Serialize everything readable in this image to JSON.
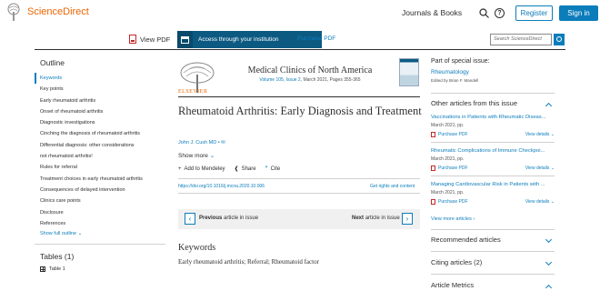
{
  "header": {
    "brand": "ScienceDirect",
    "journals_link": "Journals & Books",
    "help_glyph": "?",
    "register": "Register",
    "signin": "Sign in"
  },
  "toolbar": {
    "view_pdf": "View PDF",
    "access": "Access through your institution",
    "purchase_pdf": "Purchase PDF",
    "search_placeholder": "Search ScienceDirect"
  },
  "outline": {
    "title": "Outline",
    "items": [
      "Keywords",
      "Key points",
      "Early rheumatoid arthritis",
      "Onset of rheumatoid arthritis",
      "Diagnostic investigations",
      "Cinching the diagnosis of rheumatoid arthritis",
      "Differential diagnosis: other considerations",
      "not rheumatoid arthritis!",
      "Rules for referral",
      "Treatment choices in early rheumatoid arthritis",
      "Consequences of delayed intervention",
      "Clinics care points",
      "Disclosure",
      "References"
    ],
    "show_full": "Show full outline",
    "tables_title": "Tables (1)",
    "table1": "Table 1"
  },
  "article": {
    "publisher": "ELSEVIER",
    "journal": "Medical Clinics of North America",
    "volume": "Volume 105, Issue 2",
    "meta": ", March 2021, Pages 355-365",
    "title": "Rheumatoid Arthritis: Early Diagnosis and Treatment",
    "author": "John J. Cush MD",
    "show_more": "Show more",
    "add_mendeley": "Add to Mendeley",
    "share": "Share",
    "cite": "Cite",
    "doi": "https://doi.org/10.1016/j.mcna.2020.10.006",
    "rights": "Get rights and content",
    "prev_label": "Previous",
    "prev_rest": "article in issue",
    "next_label": "Next",
    "next_rest": "article in issue",
    "keywords_title": "Keywords",
    "keywords": "Early rheumatoid arthritis; Referral; Rheumatoid factor"
  },
  "sidebar": {
    "special_issue_title": "Part of special issue:",
    "special_issue_link": "Rheumatology",
    "edited_by": "Edited by Brian F. Mandell",
    "other_articles_title": "Other articles from this issue",
    "other_articles": [
      {
        "title": "Vaccinations in Patients with Rheumatic Diseas...",
        "date": "March 2021, pp.",
        "purchase": "Purchase PDF",
        "details": "View details"
      },
      {
        "title": "Rheumatic Complications of Immune Checkpoi...",
        "date": "March 2021, pp.",
        "purchase": "Purchase PDF",
        "details": "View details"
      },
      {
        "title": "Managing Cardiovascular Risk in Patients with ...",
        "date": "March 2021, pp.",
        "purchase": "Purchase PDF",
        "details": "View details"
      }
    ],
    "view_more": "View more articles",
    "recommended": "Recommended articles",
    "citing": "Citing articles (2)",
    "metrics": "Article Metrics"
  }
}
